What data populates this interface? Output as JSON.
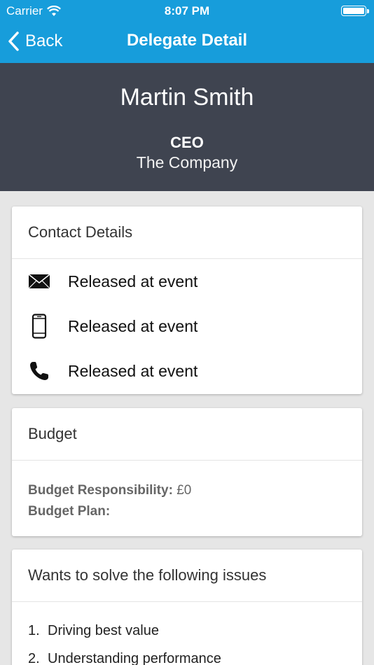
{
  "status_bar": {
    "carrier": "Carrier",
    "time": "8:07 PM",
    "icons": [
      "wifi-icon",
      "battery-icon"
    ]
  },
  "navbar": {
    "back_label": "Back",
    "title": "Delegate Detail",
    "accent_color": "#179ddb"
  },
  "delegate": {
    "name": "Martin Smith",
    "role": "CEO",
    "company": "The Company",
    "header_color": "#3f4450"
  },
  "contact_details": {
    "title": "Contact Details",
    "rows": [
      {
        "icon": "envelope-icon",
        "text": "Released at event"
      },
      {
        "icon": "mobile-phone-icon",
        "text": "Released at event"
      },
      {
        "icon": "phone-handset-icon",
        "text": "Released at event"
      }
    ]
  },
  "budget": {
    "title": "Budget",
    "responsibility_label": "Budget Responsibility:",
    "responsibility_value": "£0",
    "plan_label": "Budget Plan:",
    "plan_value": ""
  },
  "issues": {
    "title": "Wants to solve the following issues",
    "items": [
      {
        "number": "1.",
        "text": "Driving best value"
      },
      {
        "number": "2.",
        "text": "Understanding performance"
      }
    ]
  }
}
